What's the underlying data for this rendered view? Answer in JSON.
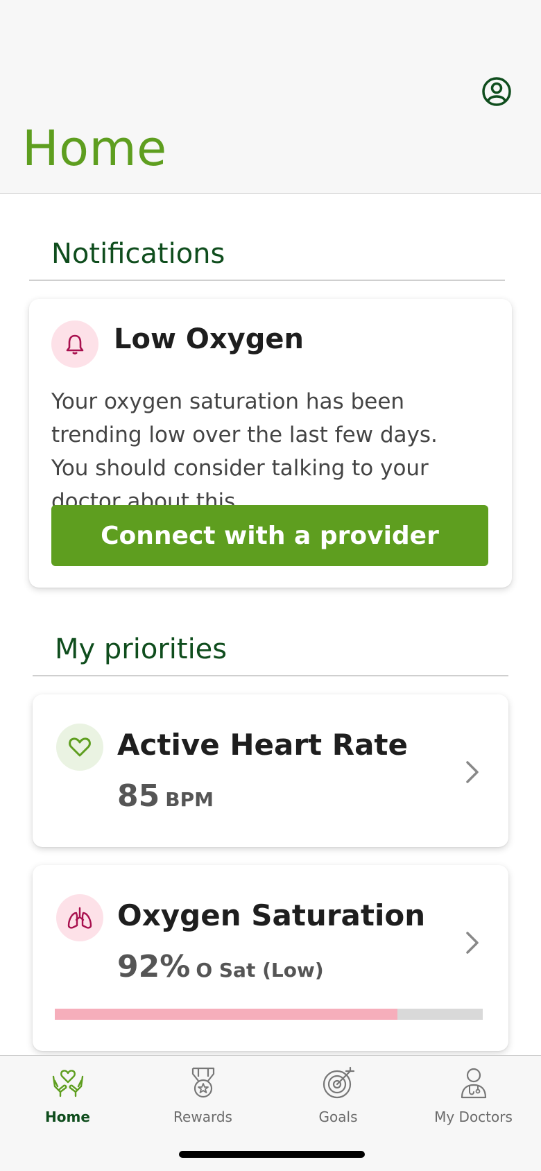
{
  "header": {
    "title": "Home"
  },
  "notifications": {
    "title": "Notifications",
    "card": {
      "title": "Low Oxygen",
      "body": "Your oxygen saturation has been trending low over the last few days. You should consider talking to your doctor about this.",
      "action_label": "Connect with a provider",
      "icon": "bell-icon"
    }
  },
  "priorities": {
    "title": "My priorities",
    "items": [
      {
        "title": "Active Heart Rate",
        "value": "85",
        "unit": "BPM",
        "icon": "heart-icon"
      },
      {
        "title": "Oxygen Saturation",
        "value": "92%",
        "unit": "O Sat (Low)",
        "icon": "lungs-icon",
        "progress": 0.8
      }
    ]
  },
  "tabs": [
    {
      "label": "Home",
      "icon": "hands-heart-icon",
      "active": true
    },
    {
      "label": "Rewards",
      "icon": "medal-icon",
      "active": false
    },
    {
      "label": "Goals",
      "icon": "target-icon",
      "active": false
    },
    {
      "label": "My Doctors",
      "icon": "doctor-icon",
      "active": false
    }
  ],
  "colors": {
    "brand_green": "#5e9e1f",
    "dark_green": "#0f4d1d",
    "alert_pink": "#fde1e8",
    "alert_magenta": "#a8104e",
    "progress_low": "#f6aebb"
  }
}
